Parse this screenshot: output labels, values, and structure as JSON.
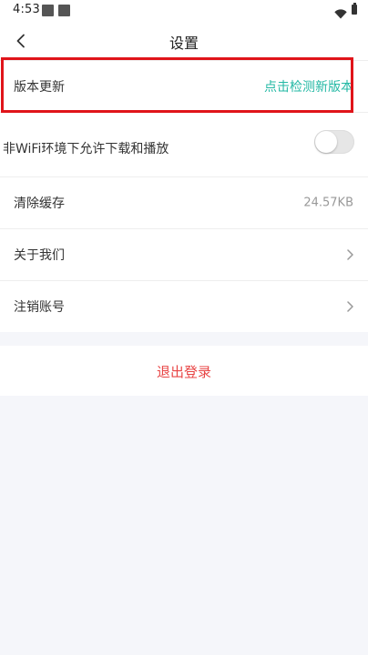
{
  "status_bar": {
    "time": "4:53",
    "icons": [
      "notification-square-icon",
      "notification-square-icon",
      "wifi-icon",
      "battery-icon"
    ]
  },
  "header": {
    "title": "设置",
    "back_icon": "chevron-left-icon"
  },
  "settings": {
    "version_update": {
      "label": "版本更新",
      "action": "点击检测新版本",
      "action_color": "#23b8a4"
    },
    "wifi_download": {
      "label": "非WiFi环境下允许下载和播放",
      "enabled": false,
      "highlight_color": "#e0141a"
    },
    "clear_cache": {
      "label": "清除缓存",
      "value": "24.57KB"
    },
    "about_us": {
      "label": "关于我们"
    },
    "delete_account": {
      "label": "注销账号"
    }
  },
  "logout": {
    "label": "退出登录",
    "color": "#e84545"
  }
}
